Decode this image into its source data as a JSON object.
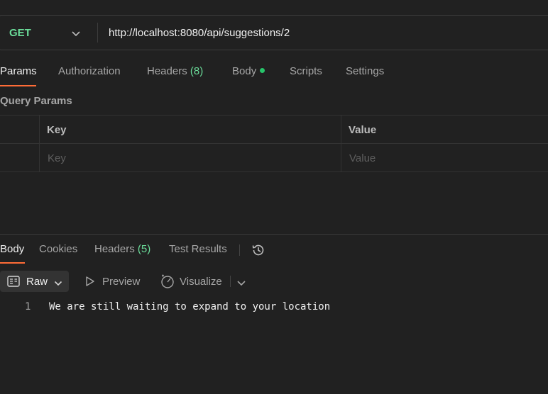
{
  "request": {
    "method": "GET",
    "url": "http://localhost:8080/api/suggestions/2"
  },
  "request_tabs": {
    "params": "Params",
    "authorization": "Authorization",
    "headers": "Headers",
    "headers_count": "(8)",
    "body": "Body",
    "scripts": "Scripts",
    "settings": "Settings",
    "active": "Params"
  },
  "query_params": {
    "title": "Query Params",
    "columns": {
      "key": "Key",
      "value": "Value"
    },
    "row_placeholders": {
      "key": "Key",
      "value": "Value"
    }
  },
  "response_tabs": {
    "body": "Body",
    "cookies": "Cookies",
    "headers": "Headers",
    "headers_count": "(5)",
    "test_results": "Test Results",
    "active": "Body"
  },
  "response_format": {
    "selected": "Raw",
    "preview": "Preview",
    "visualize": "Visualize"
  },
  "response_body": {
    "lines": [
      {
        "number": "1",
        "text": "We are still waiting to expand to your location"
      }
    ]
  },
  "colors": {
    "accent": "#ff6c37",
    "method_get": "#6bdd9a",
    "count_green": "#6bdd9a",
    "body_dot": "#27c46a",
    "background": "#212121"
  },
  "icons": {
    "method_dropdown": "chevron-down-icon",
    "history": "history-icon",
    "raw_format": "document-icon",
    "preview": "play-icon",
    "visualize": "visualize-icon",
    "format_more": "chevron-down-icon"
  }
}
